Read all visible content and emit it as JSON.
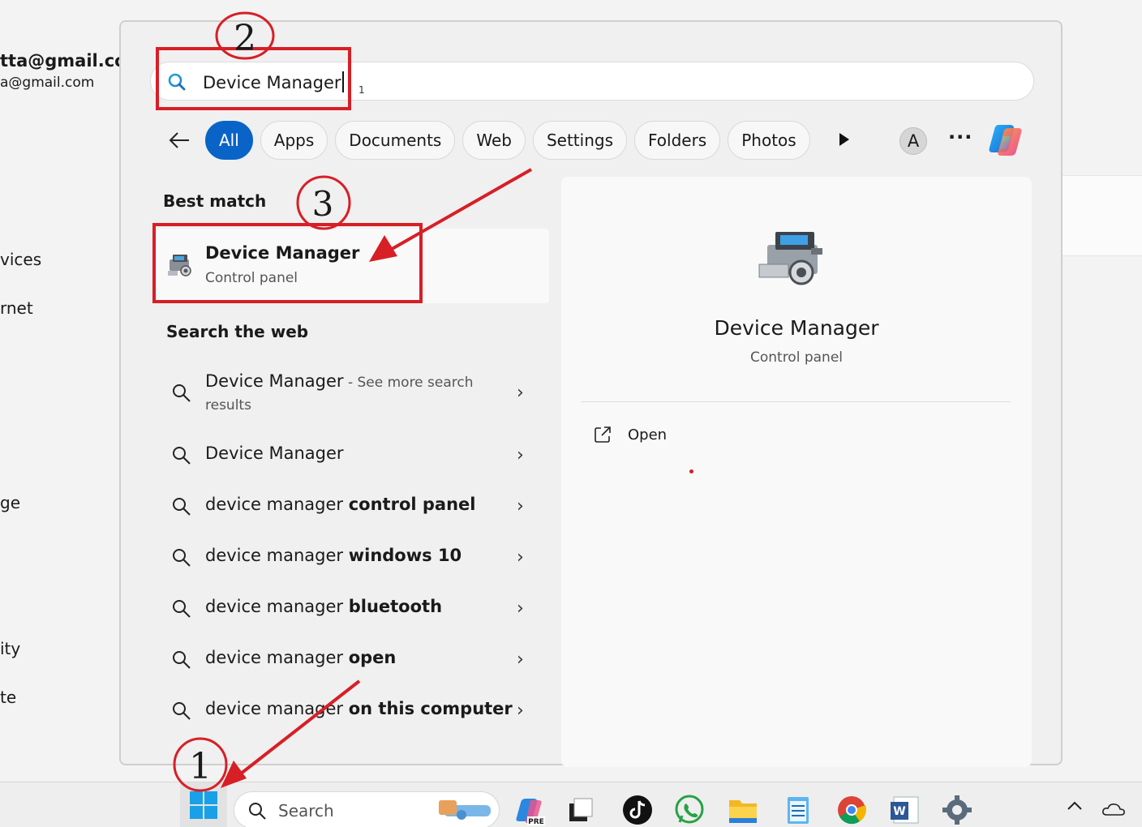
{
  "background": {
    "account_email_primary": "tta@gmail.com",
    "account_email_secondary": "a@gmail.com",
    "nav_fragments": [
      "vices",
      "rnet",
      "ge",
      "ity",
      "te"
    ]
  },
  "search": {
    "query": "Device Manager",
    "sub_marker": "1"
  },
  "filters": {
    "back_label": "Back",
    "items": [
      "All",
      "Apps",
      "Documents",
      "Web",
      "Settings",
      "Folders",
      "Photos"
    ],
    "active": "All",
    "account_initial": "A",
    "more_label": "···"
  },
  "best_match": {
    "heading": "Best match",
    "title": "Device Manager",
    "subtitle": "Control panel"
  },
  "web": {
    "heading": "Search the web",
    "first": {
      "prefix": "Device Manager",
      "suffix": " - See more search",
      "continuation": "results"
    },
    "rows": [
      {
        "normal": "Device Manager",
        "bold": ""
      },
      {
        "normal": "device manager ",
        "bold": "control panel"
      },
      {
        "normal": "device manager ",
        "bold": "windows 10"
      },
      {
        "normal": "device manager ",
        "bold": "bluetooth"
      },
      {
        "normal": "device manager ",
        "bold": "open"
      },
      {
        "normal": "device manager ",
        "bold": "on this computer"
      }
    ]
  },
  "detail": {
    "title": "Device Manager",
    "subtitle": "Control panel",
    "action_open": "Open"
  },
  "taskbar": {
    "search_placeholder": "Search",
    "pre_badge": "PRE"
  },
  "annotations": {
    "step1": "1",
    "step2": "2",
    "step3": "3",
    "color": "#d71f26"
  }
}
